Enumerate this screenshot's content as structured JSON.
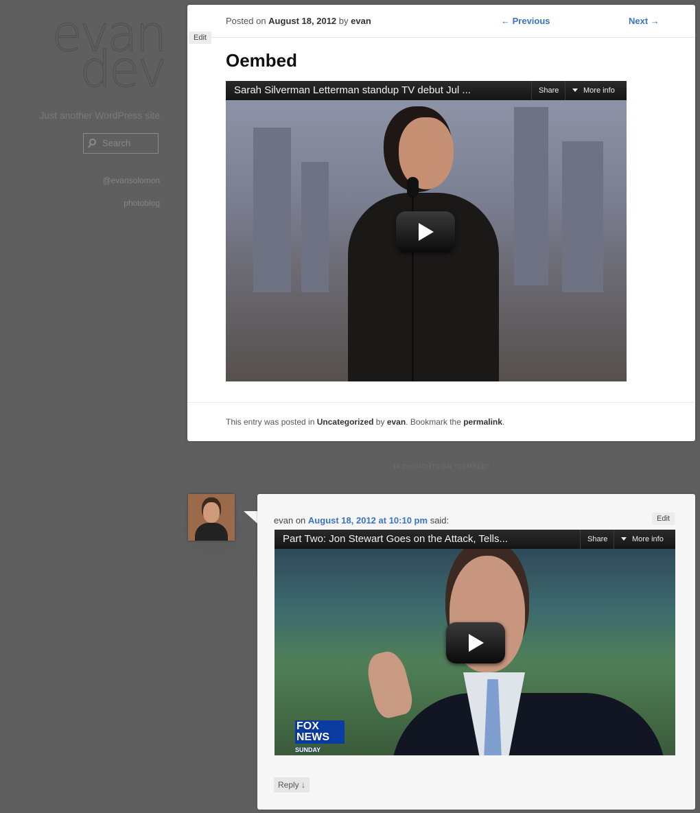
{
  "sidebar": {
    "logo_line1": "evan",
    "logo_line2": "dev",
    "tagline": "Just another WordPress site",
    "search_placeholder": "Search",
    "links": [
      "@evansolomon",
      "photoblog"
    ]
  },
  "article": {
    "meta_posted": "Posted on",
    "meta_date": "August 18, 2012",
    "meta_by": "by",
    "meta_author": "evan",
    "prev_label": "← Previous",
    "next_label": "Next →",
    "edit_label": "Edit",
    "title": "Oembed",
    "video": {
      "title": "Sarah Silverman Letterman standup TV debut Jul ...",
      "share_label": "Share",
      "more_info_label": "More info"
    },
    "footer_prefix": "This entry was posted in",
    "footer_category": "Uncategorized",
    "footer_by": "by",
    "footer_author": "evan",
    "footer_bookmark": ". Bookmark the",
    "footer_permalink": "permalink",
    "footer_end": "."
  },
  "comments": {
    "heading": "14 THOUGHTS ON \"OEMBED\"",
    "items": [
      {
        "author": "evan",
        "on": "on",
        "date": "August 18, 2012 at 10:10 pm",
        "said": "said:",
        "edit_label": "Edit",
        "video": {
          "title": "Part Two: Jon Stewart Goes on the Attack, Tells...",
          "share_label": "Share",
          "more_info_label": "More info",
          "logo_line1": "FOX NEWS",
          "logo_line2": "SUNDAY"
        },
        "reply_label": "Reply ↓"
      }
    ]
  },
  "colors": {
    "page_background": "#5f5f5f",
    "link_blue": "#3a74c4",
    "card_background": "#ffffff",
    "comment_background": "#f6f6f6"
  }
}
